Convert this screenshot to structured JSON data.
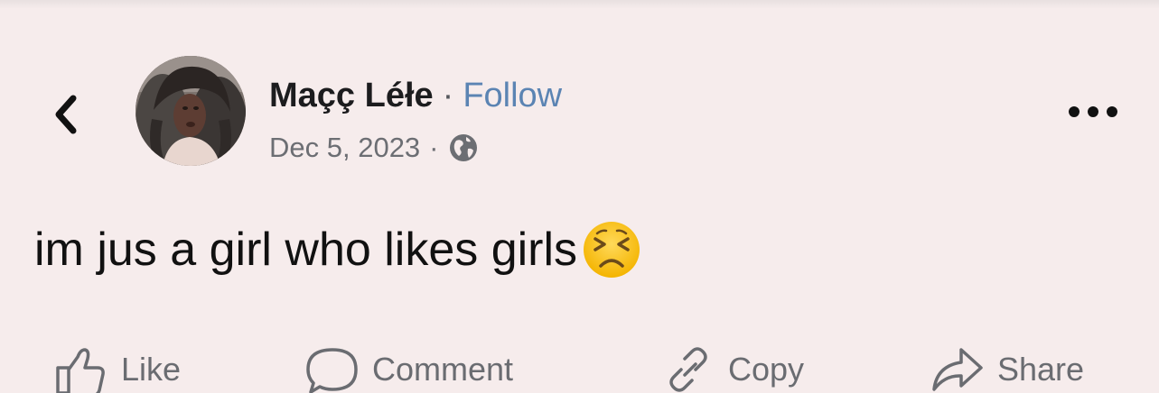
{
  "post": {
    "author": "Maçç Léłe",
    "separator": "·",
    "follow_label": "Follow",
    "date": "Dec 5, 2023",
    "date_separator": "·",
    "privacy_icon": "globe-icon",
    "text": "im jus a girl who likes girls",
    "emoji": "persevering-face-emoji"
  },
  "header": {
    "back_icon": "chevron-left-icon",
    "more_icon": "more-horizontal-icon"
  },
  "actions": [
    {
      "label": "Like",
      "icon": "thumbs-up-icon"
    },
    {
      "label": "Comment",
      "icon": "comment-icon"
    },
    {
      "label": "Copy",
      "icon": "link-icon"
    },
    {
      "label": "Share",
      "icon": "share-icon"
    }
  ],
  "colors": {
    "background": "#f6ecec",
    "follow": "#5b84b3",
    "muted": "#6c6e73"
  }
}
